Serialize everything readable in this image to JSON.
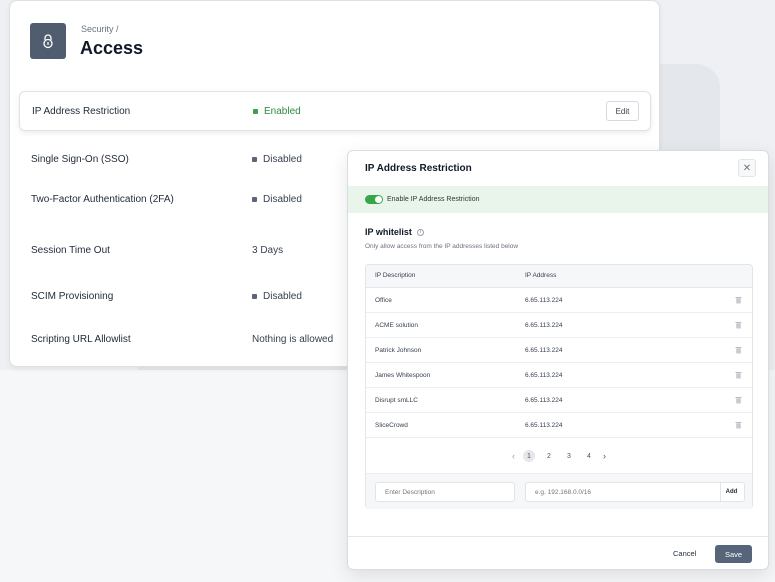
{
  "header": {
    "breadcrumb": "Security /",
    "title": "Access",
    "icon": "lock-icon"
  },
  "settings": [
    {
      "name": "IP Address Restriction",
      "status": "Enabled",
      "has_dot": true,
      "state": "enabled",
      "action": "Edit"
    },
    {
      "name": "Single Sign-On (SSO)",
      "status": "Disabled",
      "has_dot": true,
      "state": "disabled"
    },
    {
      "name": "Two-Factor Authentication (2FA)",
      "status": "Disabled",
      "has_dot": true,
      "state": "disabled"
    },
    {
      "name": "Session Time Out",
      "status": "3 Days",
      "has_dot": false,
      "state": "value"
    },
    {
      "name": "SCIM Provisioning",
      "status": "Disabled",
      "has_dot": true,
      "state": "disabled"
    },
    {
      "name": "Scripting URL Allowlist",
      "status": "Nothing is allowed",
      "has_dot": false,
      "state": "value"
    }
  ],
  "modal": {
    "title": "IP Address Restriction",
    "close_icon": "close-icon",
    "toggle_label": "Enable IP Address Restriction",
    "toggle_on": true,
    "whitelist_title": "IP whitelist",
    "whitelist_desc": "Only allow access from the IP addresses listed below",
    "columns": [
      "IP Description",
      "IP Address"
    ],
    "rows": [
      {
        "description": "Office",
        "ip": "6.65.113.224"
      },
      {
        "description": "ACME solution",
        "ip": "6.65.113.224"
      },
      {
        "description": "Patrick Johnson",
        "ip": "6.65.113.224"
      },
      {
        "description": "James Whitespoon",
        "ip": "6.65.113.224"
      },
      {
        "description": "Disrupt smLLC",
        "ip": "6.65.113.224"
      },
      {
        "description": "SliceCrowd",
        "ip": "6.65.113.224"
      }
    ],
    "pagination": {
      "pages": [
        "1",
        "2",
        "3",
        "4"
      ],
      "current": "1"
    },
    "add": {
      "description_placeholder": "Enter Description",
      "ip_placeholder": "e.g. 192.168.0.0/16",
      "button": "Add"
    },
    "cancel": "Cancel",
    "save": "Save"
  },
  "colors": {
    "enabled": "#3aa24a",
    "toggle_bg": "#e9f5ea",
    "primary_button": "#56657a",
    "icon_box": "#4f5d6e"
  }
}
